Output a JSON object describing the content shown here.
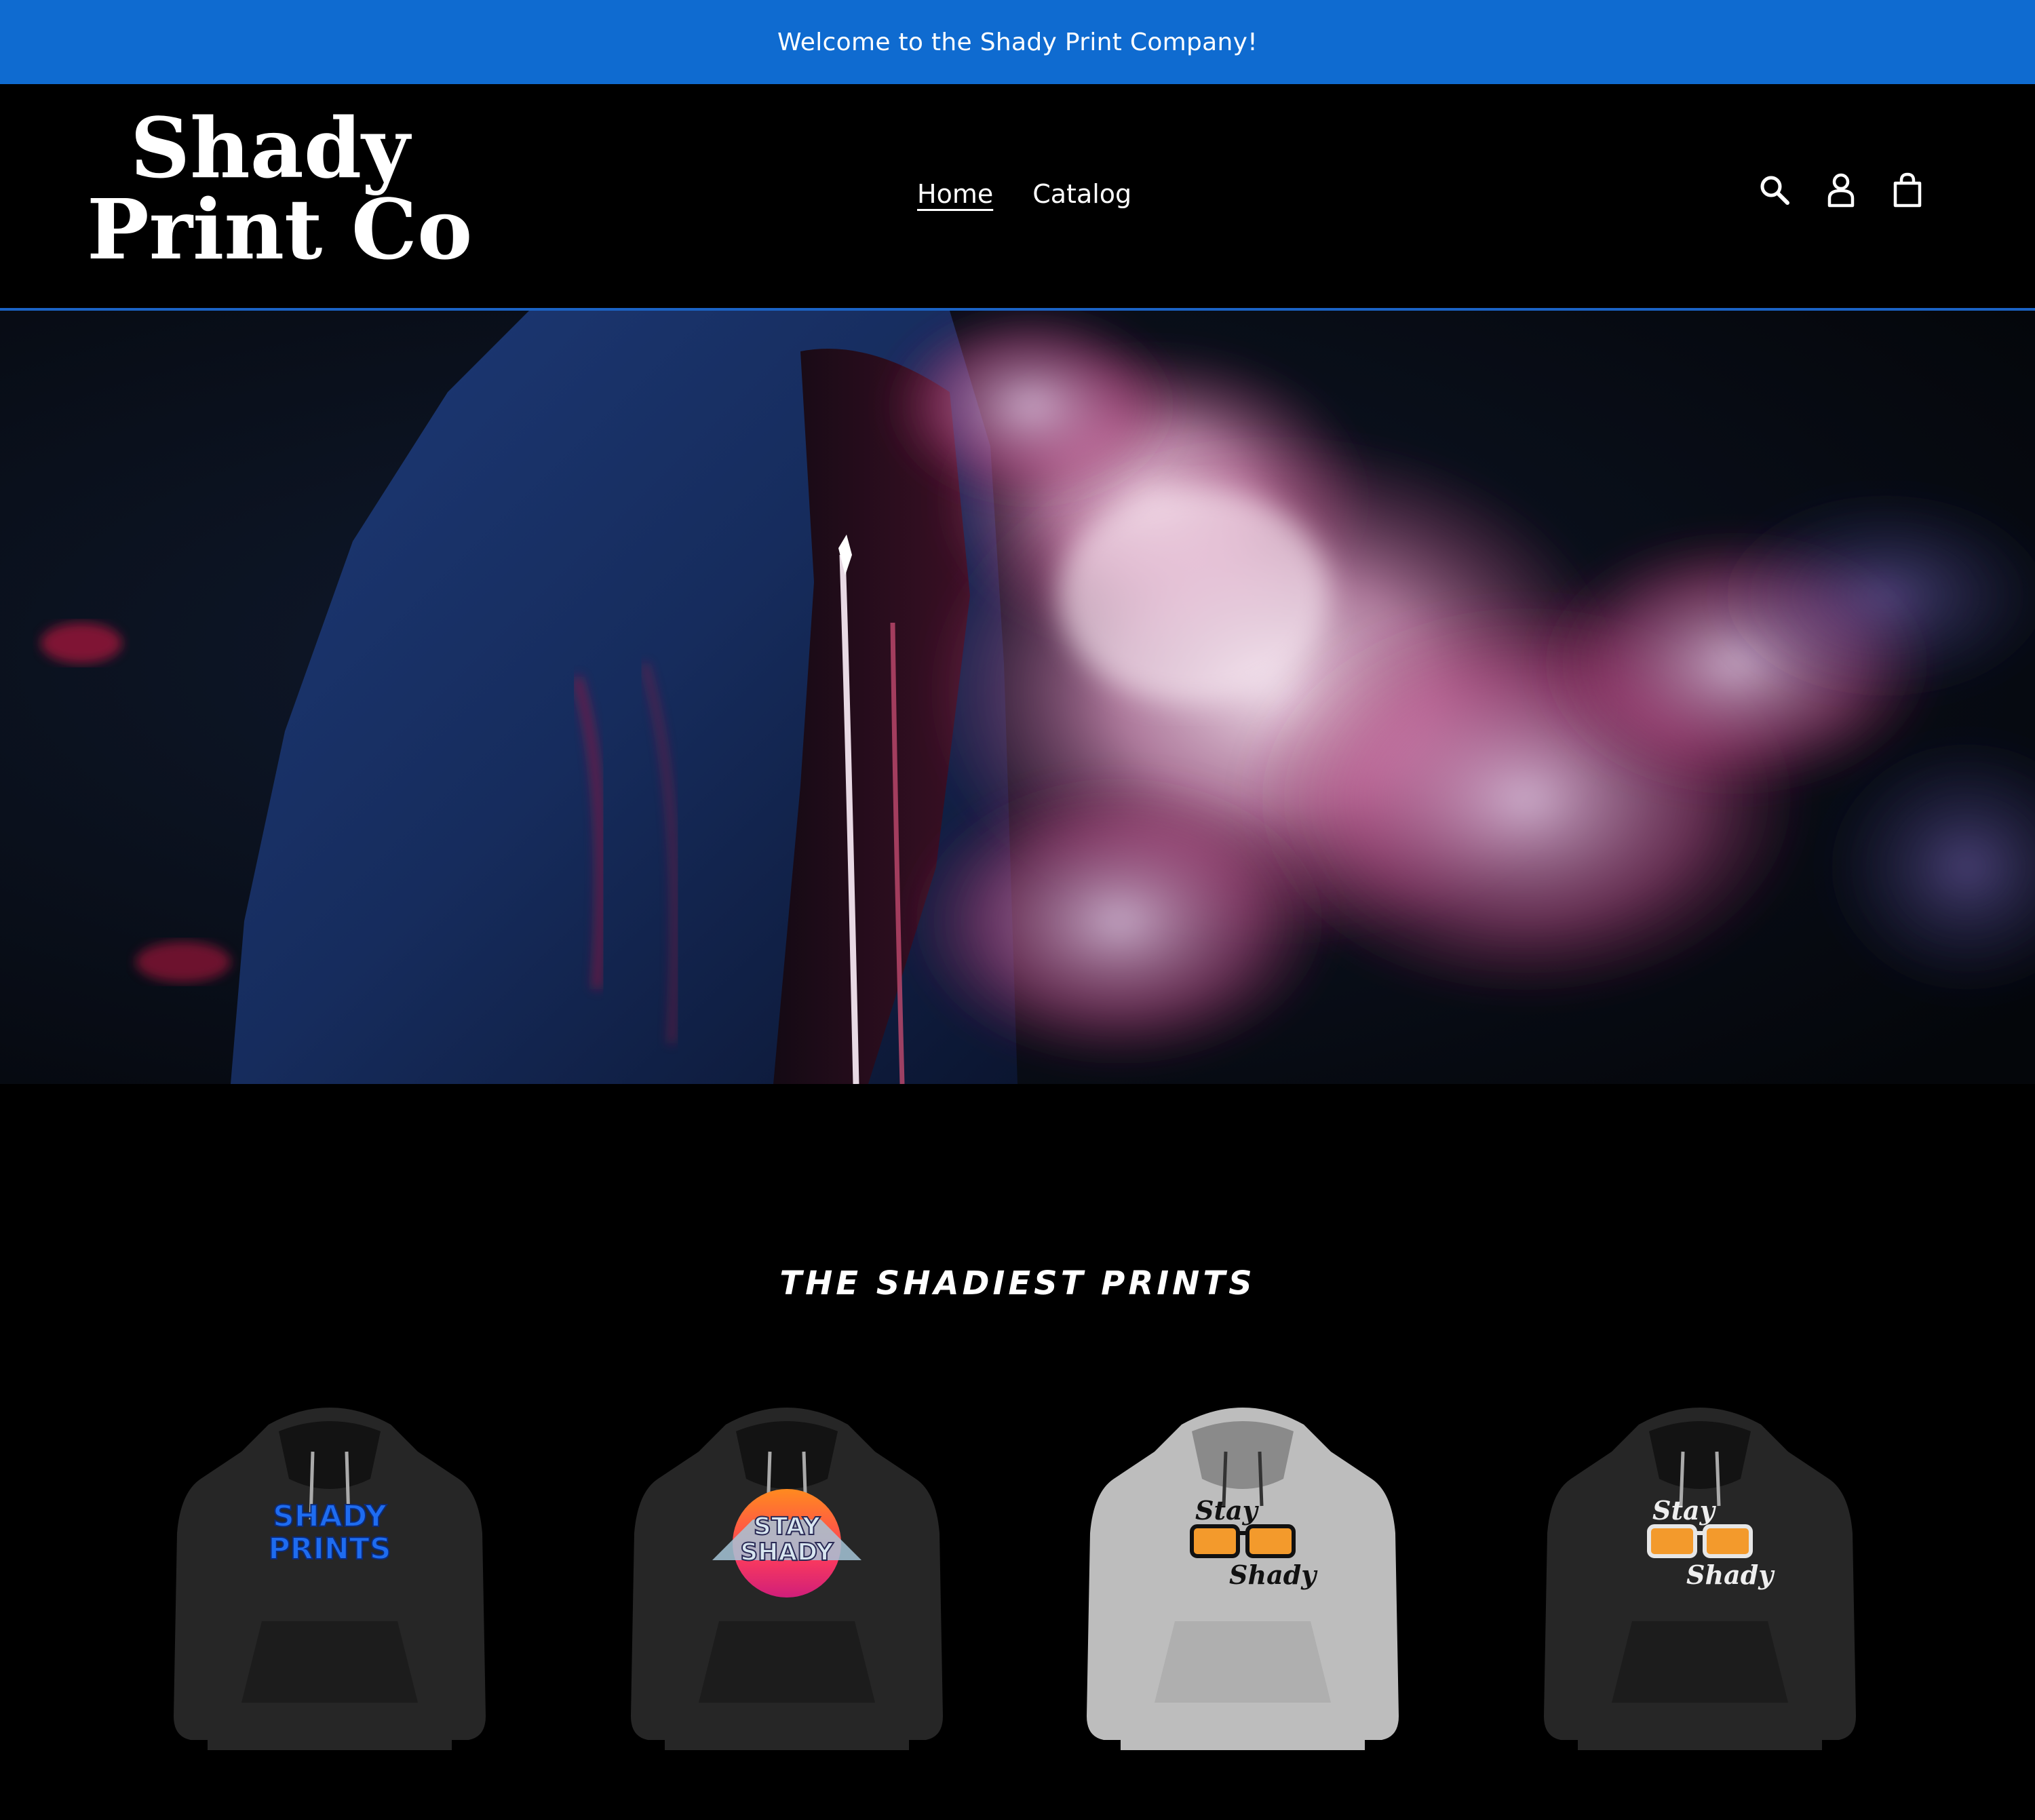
{
  "announcement": {
    "text": "Welcome to the Shady Print Company!",
    "bg_color": "#0f6bd0"
  },
  "header": {
    "logo": {
      "line1": "Shady",
      "line2": "Print Co"
    },
    "nav": [
      {
        "label": "Home",
        "active": true
      },
      {
        "label": "Catalog",
        "active": false
      }
    ],
    "icons": [
      "search-icon",
      "account-icon",
      "cart-icon"
    ]
  },
  "hero": {
    "image": "hooded-figure-with-pink-smoke"
  },
  "featured": {
    "title": "THE SHADIEST PRINTS",
    "products": [
      {
        "image": "black-hoodie-shady-prints-blue-graffiti",
        "hoodie_color": "#262626",
        "print_text": "SHADY PRINTS"
      },
      {
        "image": "black-hoodie-stay-shady-retro",
        "hoodie_color": "#262626",
        "print_text": "STAY SHADY"
      },
      {
        "image": "grey-hoodie-stay-shady-sunglasses",
        "hoodie_color": "#bdbdbd",
        "print_text": "Stay Shady"
      },
      {
        "image": "black-hoodie-stay-shady-sunglasses",
        "hoodie_color": "#262626",
        "print_text": "Stay Shady"
      }
    ]
  }
}
